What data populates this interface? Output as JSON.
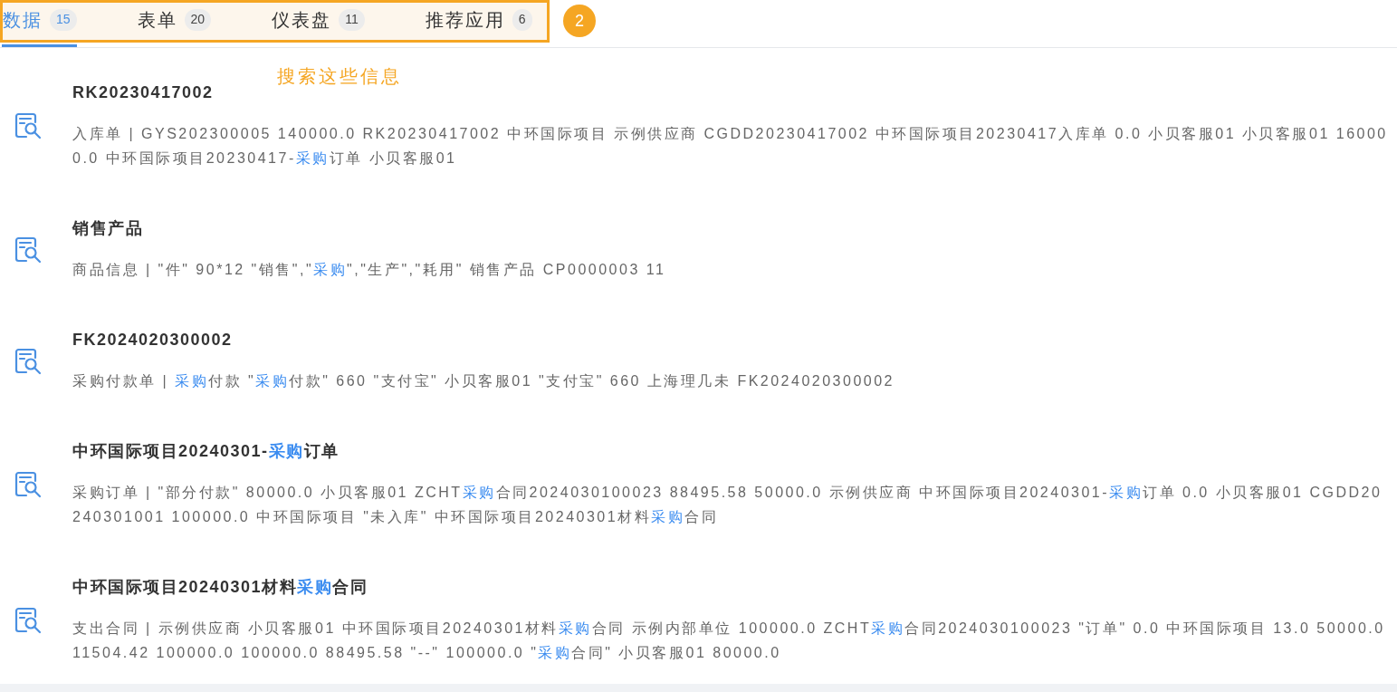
{
  "tabs": [
    {
      "label": "数据",
      "count": "15",
      "selected": true
    },
    {
      "label": "表单",
      "count": "20",
      "selected": false
    },
    {
      "label": "仪表盘",
      "count": "11",
      "selected": false
    },
    {
      "label": "推荐应用",
      "count": "6",
      "selected": false
    }
  ],
  "annotation": {
    "number": "2",
    "caption": "搜索这些信息"
  },
  "results": [
    {
      "title": [
        {
          "text": "RK20230417002",
          "highlight": false
        }
      ],
      "description": [
        {
          "text": "入库单 | GYS202300005 140000.0 RK20230417002 中环国际项目 示例供应商 CGDD20230417002 中环国际项目20230417入库单 0.0 小贝客服01 小贝客服01 160000.0 中环国际项目20230417-",
          "highlight": false
        },
        {
          "text": "采购",
          "highlight": true
        },
        {
          "text": "订单 小贝客服01",
          "highlight": false
        }
      ]
    },
    {
      "title": [
        {
          "text": "销售产品",
          "highlight": false
        }
      ],
      "description": [
        {
          "text": "商品信息 | \"件\" 90*12 \"销售\",\"",
          "highlight": false
        },
        {
          "text": "采购",
          "highlight": true
        },
        {
          "text": "\",\"生产\",\"耗用\" 销售产品 CP0000003 11",
          "highlight": false
        }
      ]
    },
    {
      "title": [
        {
          "text": "FK2024020300002",
          "highlight": false
        }
      ],
      "description": [
        {
          "text": "采购付款单 | ",
          "highlight": false
        },
        {
          "text": "采购",
          "highlight": true
        },
        {
          "text": "付款 \"",
          "highlight": false
        },
        {
          "text": "采购",
          "highlight": true
        },
        {
          "text": "付款\" 660 \"支付宝\" 小贝客服01 \"支付宝\" 660 上海理几未 FK2024020300002",
          "highlight": false
        }
      ]
    },
    {
      "title": [
        {
          "text": "中环国际项目20240301-",
          "highlight": false
        },
        {
          "text": "采购",
          "highlight": true
        },
        {
          "text": "订单",
          "highlight": false
        }
      ],
      "description": [
        {
          "text": "采购订单 | \"部分付款\" 80000.0 小贝客服01 ZCHT",
          "highlight": false
        },
        {
          "text": "采购",
          "highlight": true
        },
        {
          "text": "合同2024030100023 88495.58 50000.0 示例供应商 中环国际项目20240301-",
          "highlight": false
        },
        {
          "text": "采购",
          "highlight": true
        },
        {
          "text": "订单 0.0 小贝客服01 CGDD20240301001 100000.0 中环国际项目 \"未入库\" 中环国际项目20240301材料",
          "highlight": false
        },
        {
          "text": "采购",
          "highlight": true
        },
        {
          "text": "合同",
          "highlight": false
        }
      ]
    },
    {
      "title": [
        {
          "text": "中环国际项目20240301材料",
          "highlight": false
        },
        {
          "text": "采购",
          "highlight": true
        },
        {
          "text": "合同",
          "highlight": false
        }
      ],
      "description": [
        {
          "text": "支出合同 | 示例供应商 小贝客服01 中环国际项目20240301材料",
          "highlight": false
        },
        {
          "text": "采购",
          "highlight": true
        },
        {
          "text": "合同 示例内部单位 100000.0 ZCHT",
          "highlight": false
        },
        {
          "text": "采购",
          "highlight": true
        },
        {
          "text": "合同2024030100023 \"订单\" 0.0 中环国际项目 13.0 50000.0 11504.42 100000.0 100000.0 88495.58 \"--\" 100000.0 \"",
          "highlight": false
        },
        {
          "text": "采购",
          "highlight": true
        },
        {
          "text": "合同\" 小贝客服01 80000.0",
          "highlight": false
        }
      ]
    }
  ]
}
